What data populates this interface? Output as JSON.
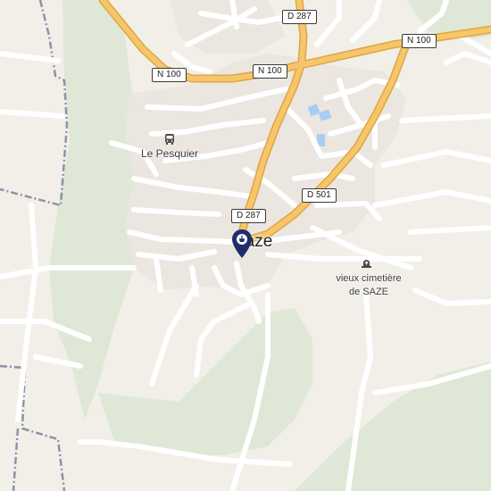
{
  "map": {
    "colors": {
      "background": "#f2efe9",
      "vegetation": "#dfe8d6",
      "built_area": "#ebe6df",
      "major_road": "#f5c66b",
      "minor_road": "#ffffff",
      "boundary": "#8d93a6",
      "water": "#a9cdf2",
      "marker": "#1f2e6b"
    },
    "roads": {
      "n100_left": "N 100",
      "n100_center": "N 100",
      "n100_right": "N 100",
      "d287_top": "D 287",
      "d287_center": "D 287",
      "d501": "D 501"
    },
    "labels": {
      "town": "Saze",
      "place_name": "Le Pesquier",
      "poi_line1": "vieux cimetière",
      "poi_line2": "de SAZE"
    },
    "icons": {
      "bus_stop": "bus-icon",
      "cemetery": "cemetery-icon",
      "location_marker": "map-pin-icon"
    }
  }
}
